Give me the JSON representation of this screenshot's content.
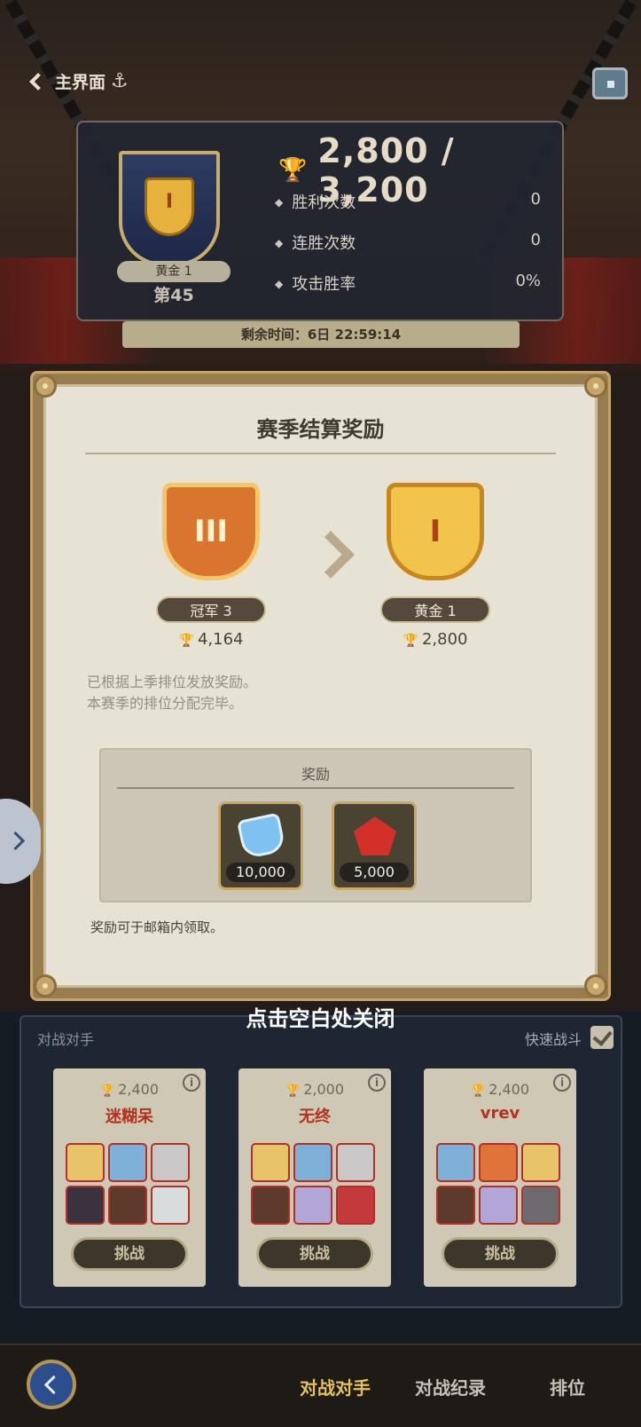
{
  "header": {
    "back_label": "主界面"
  },
  "rank": {
    "tier": "黄金 1",
    "position": "第45",
    "score": "2,800 / 3,200",
    "stats": [
      {
        "label": "胜利次数",
        "value": "0"
      },
      {
        "label": "连胜次数",
        "value": "0"
      },
      {
        "label": "攻击胜率",
        "value": "0%"
      }
    ],
    "timer": "剩余时间：6日 22:59:14"
  },
  "modal": {
    "title": "赛季结算奖励",
    "prev_tier": {
      "name": "冠军 3",
      "points": "4,164",
      "numeral": "III"
    },
    "new_tier": {
      "name": "黄金 1",
      "points": "2,800",
      "numeral": "I"
    },
    "note_line1": "已根据上季排位发放奖励。",
    "note_line2": "本赛季的排位分配完毕。",
    "reward_title": "奖励",
    "rewards": [
      {
        "icon": "diamond-icon",
        "amount": "10,000"
      },
      {
        "icon": "pentagon-token-icon",
        "amount": "5,000"
      }
    ],
    "claim_note": "奖励可于邮箱内领取。",
    "tap_close": "点击空白处关闭"
  },
  "opponents": {
    "header_label": "对战对手",
    "quick_battle_label": "快速战斗",
    "challenge_label": "挑战",
    "cards": [
      {
        "points": "2,400",
        "name": "迷糊呆",
        "heroes": [
          "#e8c36a",
          "#7fb0d8",
          "#c9c7c7",
          "#3b3240",
          "#5e3a2c",
          "#d8dcdc"
        ]
      },
      {
        "points": "2,000",
        "name": "无终",
        "heroes": [
          "#e8c36a",
          "#7fb0d8",
          "#c9c7c7",
          "#5e3a2c",
          "#b2a6d6",
          "#c4393c"
        ]
      },
      {
        "points": "2,400",
        "name": "vrev",
        "heroes": [
          "#7fb0d8",
          "#e0733a",
          "#e8c36a",
          "#5e3a2c",
          "#b2a6d6",
          "#6e6b70"
        ]
      }
    ]
  },
  "nav": {
    "items": [
      "对战对手",
      "对战纪录",
      "排位"
    ],
    "active_index": 0
  },
  "colors": {
    "accent_gold": "#e6c05a",
    "name_red": "#b3321e"
  }
}
